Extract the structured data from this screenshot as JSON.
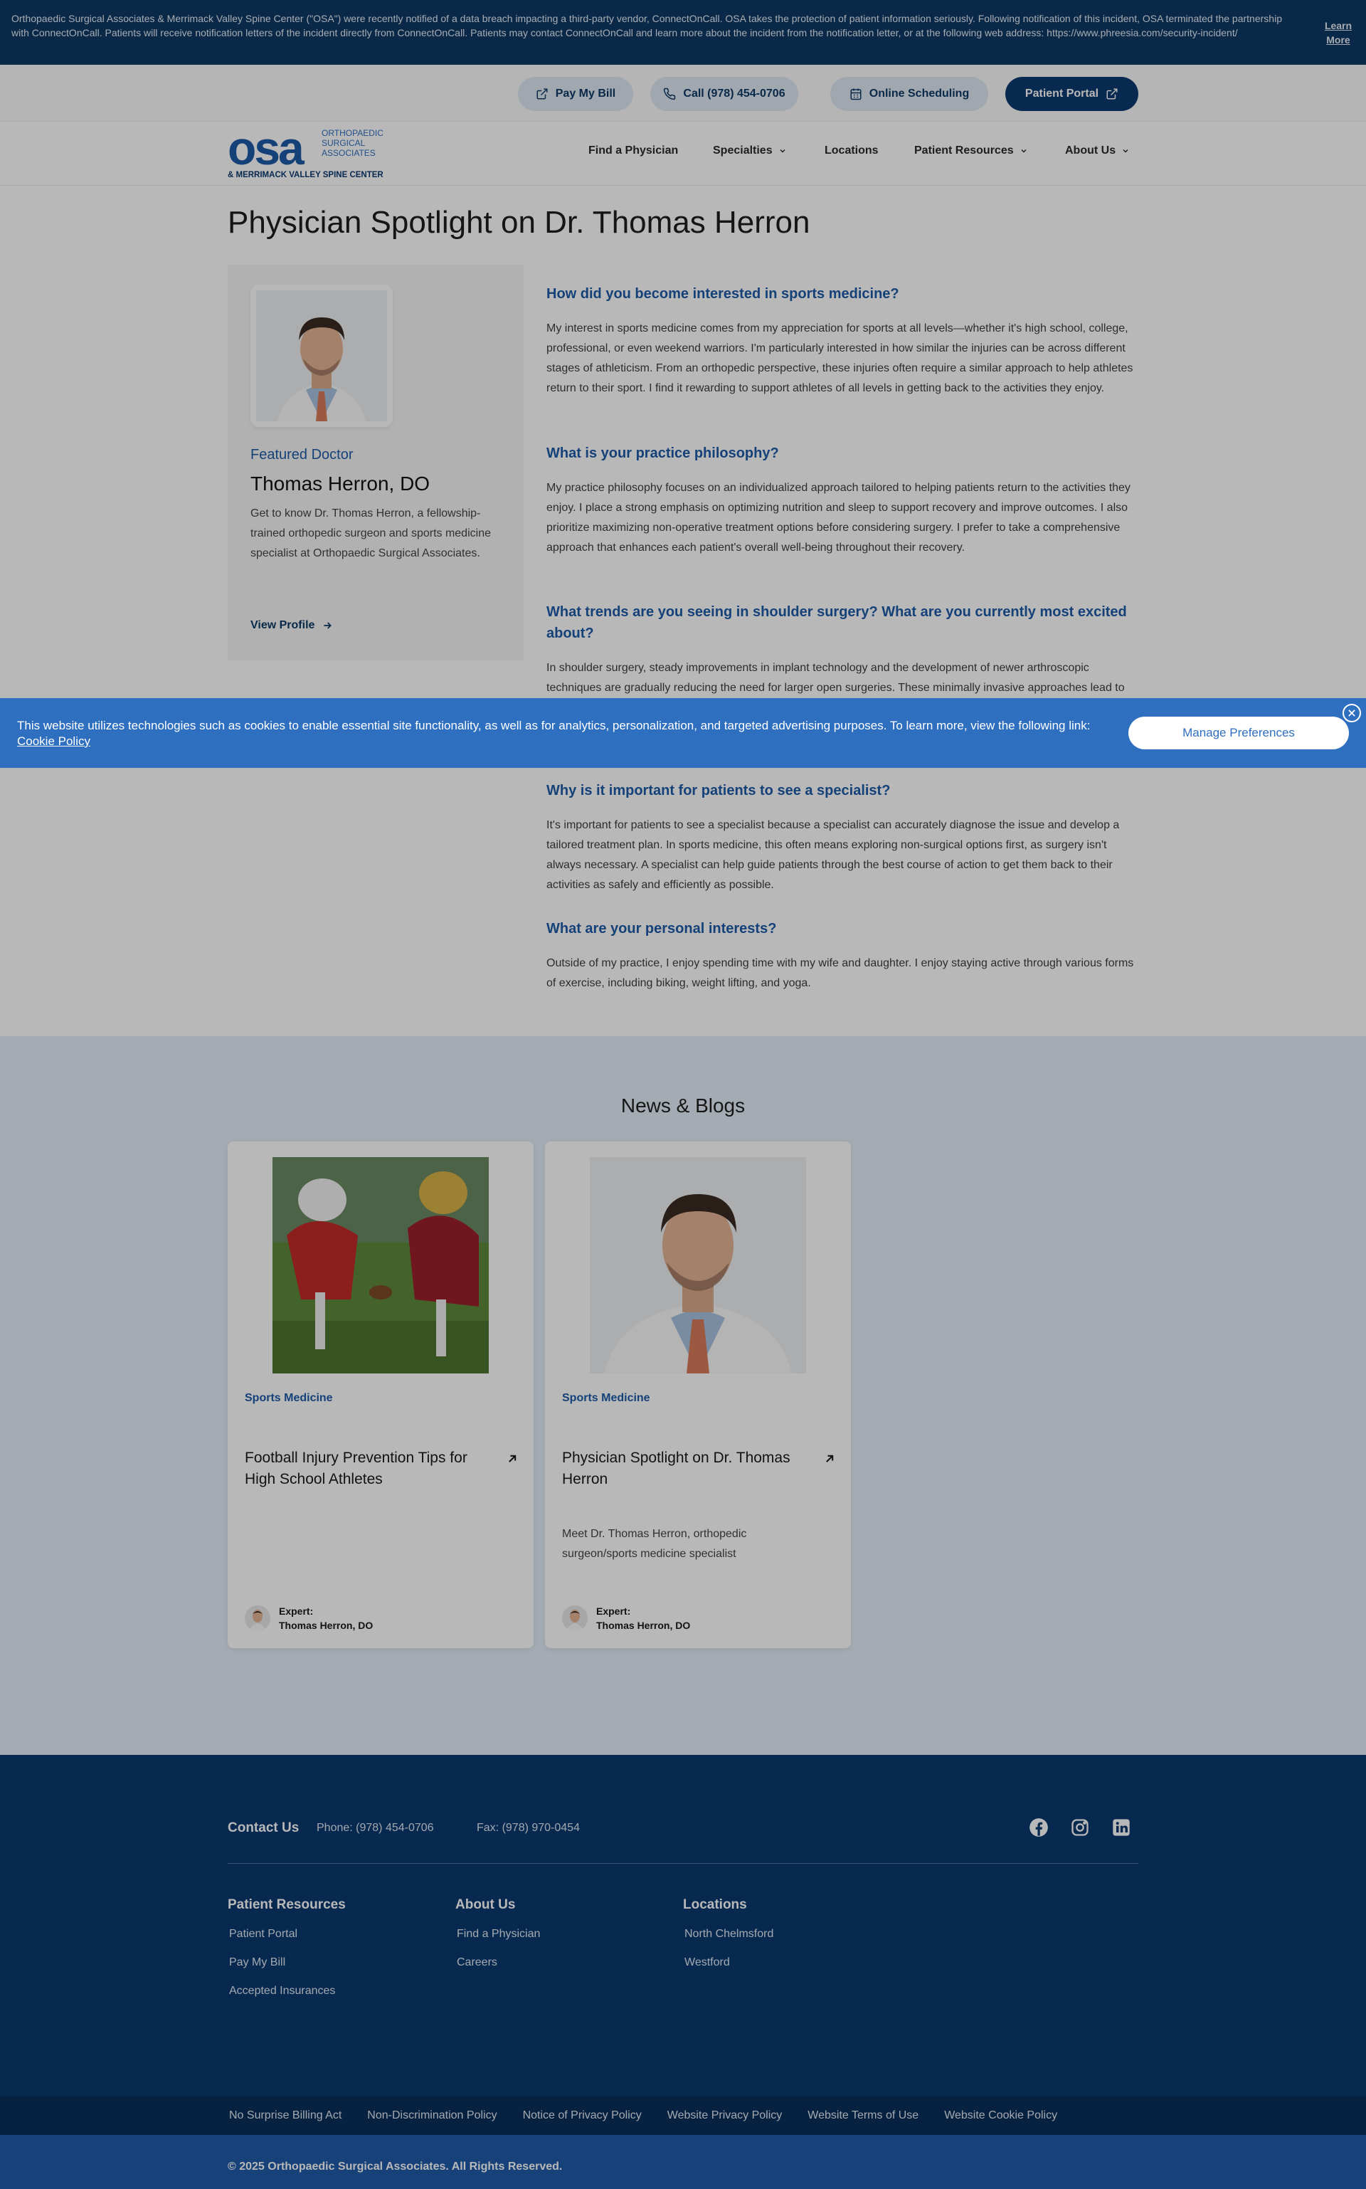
{
  "notice": {
    "text": "Orthopaedic Surgical Associates & Merrimack Valley Spine Center (\"OSA\") were recently notified of a data breach impacting a third-party vendor, ConnectOnCall. OSA takes the protection of patient information seriously. Following notification of this incident, OSA terminated the partnership with ConnectOnCall. Patients will receive notification letters of the incident directly from ConnectOnCall. Patients may contact ConnectOnCall and learn more about the incident from the notification letter, or at the following web address: https://www.phreesia.com/security-incident/",
    "learn_more_line1": "Learn",
    "learn_more_line2": "More"
  },
  "utility": {
    "pay_bill": "Pay My Bill",
    "call": "Call (978) 454-0706",
    "scheduling": "Online Scheduling",
    "portal": "Patient Portal"
  },
  "logo": {
    "mark": "osa",
    "line1": "ORTHOPAEDIC",
    "line2": "SURGICAL",
    "line3": "ASSOCIATES",
    "line4": "& MERRIMACK VALLEY SPINE CENTER"
  },
  "nav": {
    "find": "Find a Physician",
    "specialties": "Specialties",
    "locations": "Locations",
    "resources": "Patient Resources",
    "about": "About Us"
  },
  "page": {
    "title": "Physician Spotlight on Dr. Thomas Herron"
  },
  "doctor": {
    "featured": "Featured Doctor",
    "name": "Thomas Herron, DO",
    "description": "Get to know Dr. Thomas Herron, a fellowship-trained orthopedic surgeon and sports medicine specialist at Orthopaedic Surgical Associates.",
    "view_profile": "View Profile"
  },
  "qa": [
    {
      "q": "How did you become interested in sports medicine?",
      "a": "My interest in sports medicine comes from my appreciation for sports at all levels—whether it's high school, college, professional, or even weekend warriors. I'm particularly interested in how similar the injuries can be across different stages of athleticism. From an orthopedic perspective, these injuries often require a similar approach to help athletes return to their sport. I find it rewarding to support athletes of all levels in getting back to the activities they enjoy."
    },
    {
      "q": "What is your practice philosophy?",
      "a": "My practice philosophy focuses on an individualized approach tailored to helping patients return to the activities they enjoy. I place a strong emphasis on optimizing nutrition and sleep to support recovery and improve outcomes. I also prioritize maximizing non-operative treatment options before considering surgery. I prefer to take a comprehensive approach that enhances each patient's overall well-being throughout their recovery."
    },
    {
      "q": "What trends are you seeing in shoulder surgery? What are you currently most excited about?",
      "a": "In shoulder surgery, steady improvements in implant technology and the development of newer arthroscopic techniques are gradually reducing the need for larger open surgeries. These minimally invasive approaches lead to quicker recovery and less discomfort for patients. Additionally, advancements in pain control are enabling more shoulder replacements to be performed in an outpatient setting, which is convenient for patients, allowing for more accelerated rehabilitation in some cases."
    },
    {
      "q": "Why is it important for patients to see a specialist?",
      "a": "It's important for patients to see a specialist because a specialist can accurately diagnose the issue and develop a tailored treatment plan. In sports medicine, this often means exploring non-surgical options first, as surgery isn't always necessary. A specialist can help guide patients through the best course of action to get them back to their activities as safely and efficiently as possible."
    },
    {
      "q": "What are your personal interests?",
      "a": "Outside of my practice, I enjoy spending time with my wife and daughter. I enjoy staying active through various forms of exercise, including biking, weight lifting, and yoga."
    }
  ],
  "cookie": {
    "text": "This website utilizes technologies such as cookies to enable essential site functionality, as well as for analytics, personalization, and targeted advertising purposes. To learn more, view the following link:",
    "link": "Cookie Policy",
    "manage": "Manage Preferences"
  },
  "news": {
    "heading": "News & Blogs",
    "cards": [
      {
        "category": "Sports Medicine",
        "title": "Football Injury Prevention Tips for High School Athletes",
        "description": "",
        "expert_label": "Expert:",
        "expert_name": "Thomas Herron, DO"
      },
      {
        "category": "Sports Medicine",
        "title": "Physician Spotlight on Dr. Thomas Herron",
        "description": "Meet Dr. Thomas Herron, orthopedic surgeon/sports medicine specialist",
        "expert_label": "Expert:",
        "expert_name": "Thomas Herron, DO"
      }
    ]
  },
  "footer": {
    "contact": "Contact Us",
    "phone": "Phone: (978) 454-0706",
    "fax": "Fax: (978) 970-0454",
    "columns": [
      {
        "title": "Patient Resources",
        "links": [
          "Patient Portal",
          "Pay My Bill",
          "Accepted Insurances"
        ]
      },
      {
        "title": "About Us",
        "links": [
          "Find a Physician",
          "Careers"
        ]
      },
      {
        "title": "Locations",
        "links": [
          "North Chelmsford",
          "Westford"
        ]
      }
    ],
    "legal_links": [
      "No Surprise Billing Act",
      "Non-Discrimination Policy",
      "Notice of Privacy Policy",
      "Website Privacy Policy",
      "Website Terms of Use",
      "Website Cookie Policy"
    ],
    "copyright": "© 2025 Orthopaedic Surgical Associates. All Rights Reserved."
  },
  "colors": {
    "brand_navy": "#0c3a70",
    "brand_blue": "#1e5ba8",
    "cookie_blue": "#2f6fc0"
  },
  "icons": [
    "external-link-icon",
    "phone-icon",
    "calendar-icon",
    "chevron-down-icon",
    "arrow-right-icon",
    "arrow-up-right-icon",
    "close-icon",
    "facebook-icon",
    "instagram-icon",
    "linkedin-icon"
  ]
}
